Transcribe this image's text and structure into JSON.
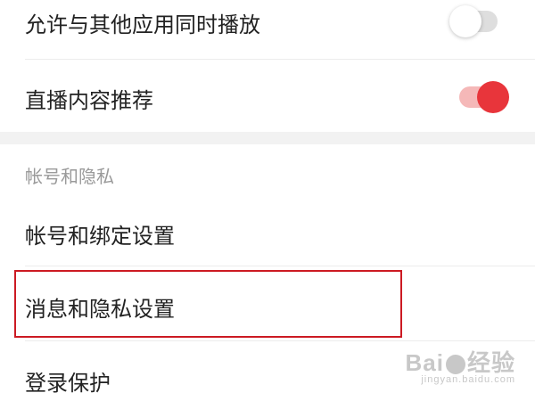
{
  "settings": {
    "rows": [
      {
        "label": "允许与其他应用同时播放",
        "toggle": "off"
      },
      {
        "label": "直播内容推荐",
        "toggle": "on"
      }
    ],
    "section_header": "帐号和隐私",
    "account_rows": [
      {
        "label": "帐号和绑定设置"
      },
      {
        "label": "消息和隐私设置"
      },
      {
        "label": "登录保护"
      }
    ]
  },
  "colors": {
    "accent": "#e8353b",
    "highlight_border": "#cc1a23"
  },
  "watermark": {
    "brand_left": "Bai",
    "brand_right": "经验",
    "url": "jingyan.baidu.com"
  }
}
